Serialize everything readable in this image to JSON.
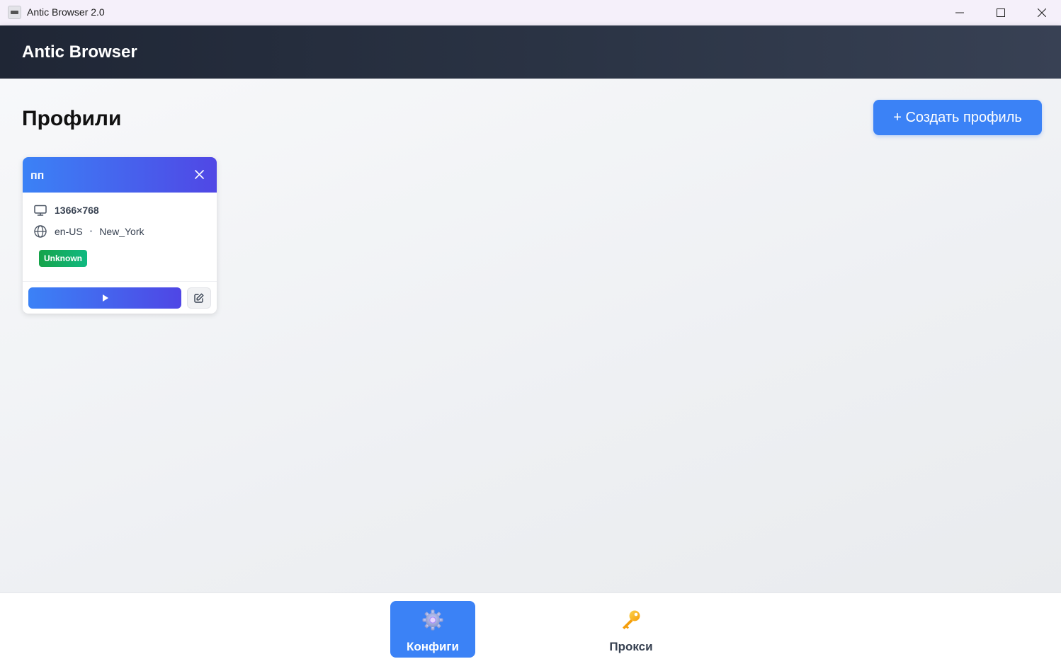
{
  "window": {
    "title": "Antic Browser 2.0"
  },
  "header": {
    "brand": "Antic Browser"
  },
  "main": {
    "title": "Профили",
    "create_button_label": "+ Создать профиль"
  },
  "profiles": [
    {
      "name": "пп",
      "resolution": "1366×768",
      "language": "en-US",
      "separator": "•",
      "timezone": "New_York",
      "status": "Unknown"
    }
  ],
  "bottom_nav": {
    "items": [
      {
        "label": "Конфиги",
        "icon": "gear-icon",
        "active": true
      },
      {
        "label": "Прокси",
        "icon": "key-icon",
        "active": false
      }
    ]
  },
  "colors": {
    "accent": "#3b82f6",
    "accent_secondary": "#5047e5",
    "header_bg": "#1f2635",
    "status_green": "#10b981"
  }
}
